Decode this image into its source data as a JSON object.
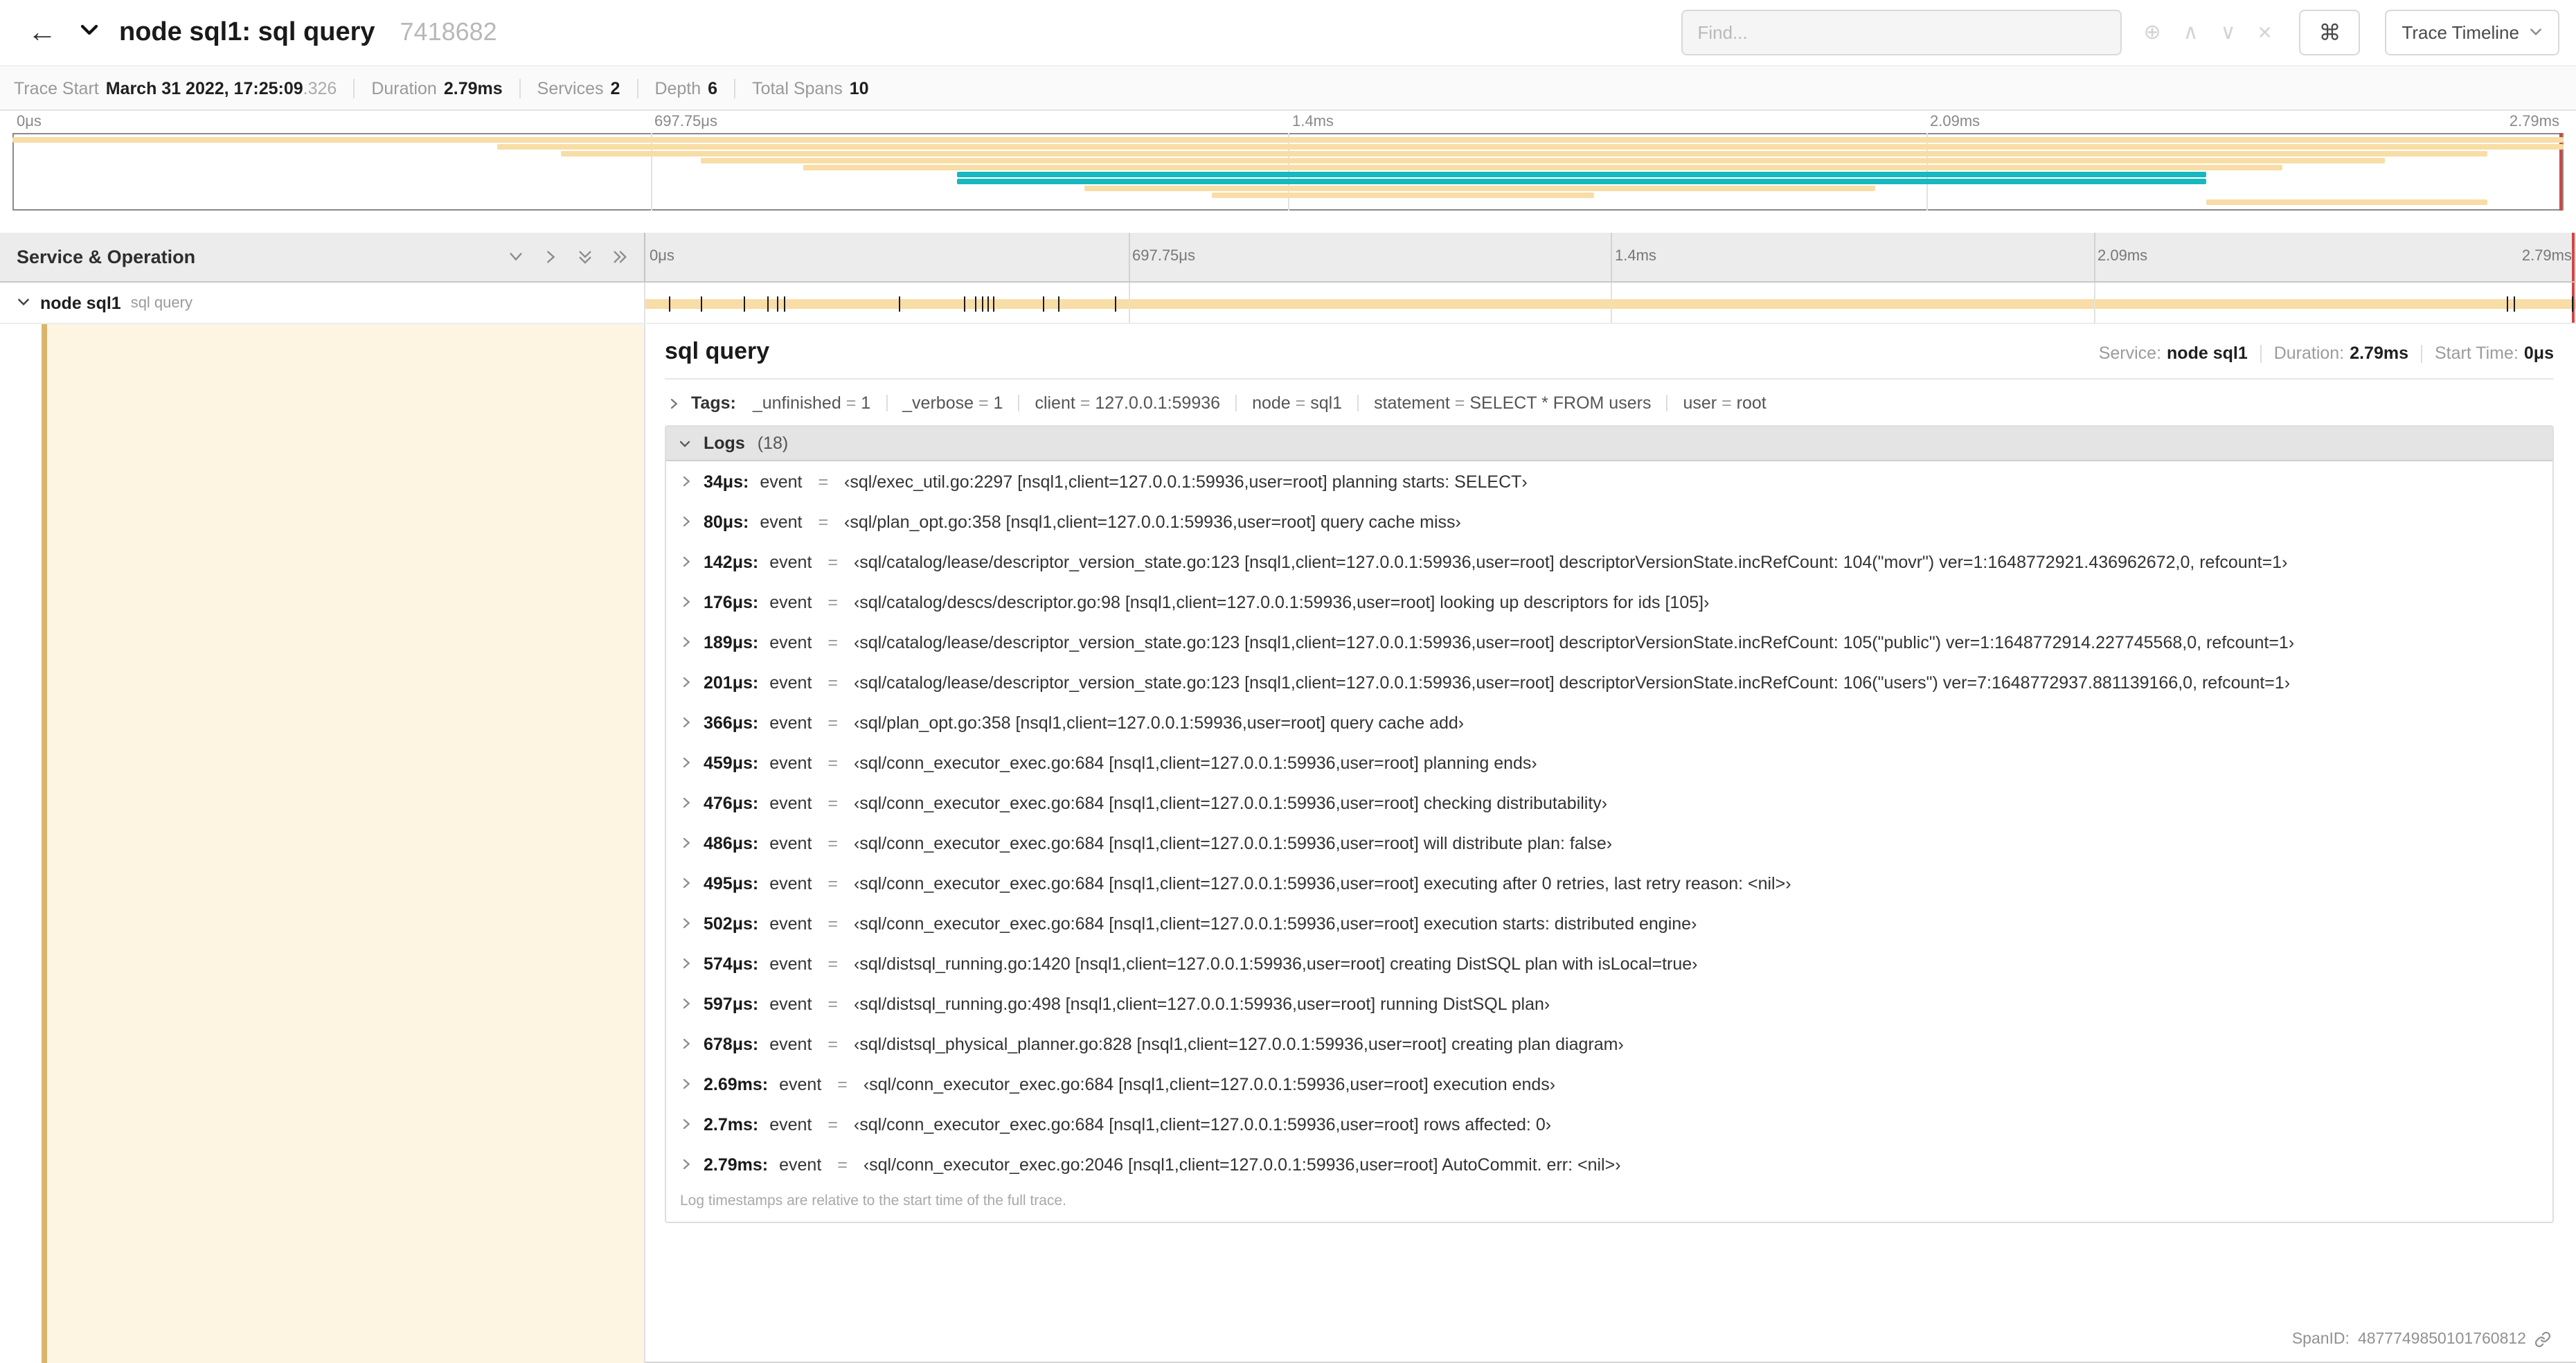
{
  "header": {
    "title": "node sql1: sql query",
    "trace_id": "7418682",
    "find_placeholder": "Find...",
    "command_key": "⌘",
    "view_selector": "Trace Timeline"
  },
  "summary": {
    "items": [
      {
        "label": "Trace Start",
        "value": "March 31 2022, 17:25:09",
        "suffix": ".326"
      },
      {
        "label": "Duration",
        "value": "2.79ms"
      },
      {
        "label": "Services",
        "value": "2"
      },
      {
        "label": "Depth",
        "value": "6"
      },
      {
        "label": "Total Spans",
        "value": "10"
      }
    ]
  },
  "timeline": {
    "ticks": [
      "0μs",
      "697.75μs",
      "1.4ms",
      "2.09ms",
      "2.79ms"
    ],
    "colors": {
      "tan": "#F8DDA6",
      "teal": "#17B8BE"
    },
    "minimap_spans": [
      {
        "row": 0,
        "start": 0,
        "end": 100,
        "color": "tan"
      },
      {
        "row": 1,
        "start": 19,
        "end": 100,
        "color": "tan"
      },
      {
        "row": 2,
        "start": 21.5,
        "end": 97,
        "color": "tan"
      },
      {
        "row": 3,
        "start": 27,
        "end": 93,
        "color": "tan"
      },
      {
        "row": 4,
        "start": 31,
        "end": 89,
        "color": "tan"
      },
      {
        "row": 5,
        "start": 37,
        "end": 86,
        "color": "teal"
      },
      {
        "row": 6,
        "start": 37,
        "end": 86,
        "color": "teal"
      },
      {
        "row": 7,
        "start": 42,
        "end": 73,
        "color": "tan"
      },
      {
        "row": 8,
        "start": 47,
        "end": 62,
        "color": "tan"
      },
      {
        "row": 9,
        "start": 86,
        "end": 97,
        "color": "tan"
      }
    ],
    "log_marker_pcts": [
      1.2,
      2.9,
      5.1,
      6.3,
      6.8,
      7.2,
      13.1,
      16.5,
      17.1,
      17.4,
      17.7,
      18,
      20.6,
      21.4,
      24.3,
      96.4,
      96.8,
      99.8
    ]
  },
  "left_panel": {
    "header": "Service & Operation",
    "span": {
      "service": "node sql1",
      "operation": "sql query"
    }
  },
  "detail": {
    "title": "sql query",
    "stats": [
      {
        "label": "Service:",
        "value": "node sql1"
      },
      {
        "label": "Duration:",
        "value": "2.79ms"
      },
      {
        "label": "Start Time:",
        "value": "0μs"
      }
    ],
    "tags_label": "Tags:",
    "tags": [
      {
        "key": "_unfinished",
        "value": "1"
      },
      {
        "key": "_verbose",
        "value": "1"
      },
      {
        "key": "client",
        "value": "127.0.0.1:59936"
      },
      {
        "key": "node",
        "value": "sql1"
      },
      {
        "key": "statement",
        "value": "SELECT * FROM users"
      },
      {
        "key": "user",
        "value": "root"
      }
    ],
    "logs_title": "Logs",
    "logs_count": "(18)",
    "logs": [
      {
        "time": "34μs:",
        "key": "event",
        "value": "‹sql/exec_util.go:2297 [nsql1,client=127.0.0.1:59936,user=root] planning starts: SELECT›"
      },
      {
        "time": "80μs:",
        "key": "event",
        "value": "‹sql/plan_opt.go:358 [nsql1,client=127.0.0.1:59936,user=root] query cache miss›"
      },
      {
        "time": "142μs:",
        "key": "event",
        "value": "‹sql/catalog/lease/descriptor_version_state.go:123 [nsql1,client=127.0.0.1:59936,user=root] descriptorVersionState.incRefCount: 104(\"movr\") ver=1:1648772921.436962672,0, refcount=1›"
      },
      {
        "time": "176μs:",
        "key": "event",
        "value": "‹sql/catalog/descs/descriptor.go:98 [nsql1,client=127.0.0.1:59936,user=root] looking up descriptors for ids [105]›"
      },
      {
        "time": "189μs:",
        "key": "event",
        "value": "‹sql/catalog/lease/descriptor_version_state.go:123 [nsql1,client=127.0.0.1:59936,user=root] descriptorVersionState.incRefCount: 105(\"public\") ver=1:1648772914.227745568,0, refcount=1›"
      },
      {
        "time": "201μs:",
        "key": "event",
        "value": "‹sql/catalog/lease/descriptor_version_state.go:123 [nsql1,client=127.0.0.1:59936,user=root] descriptorVersionState.incRefCount: 106(\"users\") ver=7:1648772937.881139166,0, refcount=1›"
      },
      {
        "time": "366μs:",
        "key": "event",
        "value": "‹sql/plan_opt.go:358 [nsql1,client=127.0.0.1:59936,user=root] query cache add›"
      },
      {
        "time": "459μs:",
        "key": "event",
        "value": "‹sql/conn_executor_exec.go:684 [nsql1,client=127.0.0.1:59936,user=root] planning ends›"
      },
      {
        "time": "476μs:",
        "key": "event",
        "value": "‹sql/conn_executor_exec.go:684 [nsql1,client=127.0.0.1:59936,user=root] checking distributability›"
      },
      {
        "time": "486μs:",
        "key": "event",
        "value": "‹sql/conn_executor_exec.go:684 [nsql1,client=127.0.0.1:59936,user=root] will distribute plan: false›"
      },
      {
        "time": "495μs:",
        "key": "event",
        "value": "‹sql/conn_executor_exec.go:684 [nsql1,client=127.0.0.1:59936,user=root] executing after 0 retries, last retry reason: <nil>›"
      },
      {
        "time": "502μs:",
        "key": "event",
        "value": "‹sql/conn_executor_exec.go:684 [nsql1,client=127.0.0.1:59936,user=root] execution starts: distributed engine›"
      },
      {
        "time": "574μs:",
        "key": "event",
        "value": "‹sql/distsql_running.go:1420 [nsql1,client=127.0.0.1:59936,user=root] creating DistSQL plan with isLocal=true›"
      },
      {
        "time": "597μs:",
        "key": "event",
        "value": "‹sql/distsql_running.go:498 [nsql1,client=127.0.0.1:59936,user=root] running DistSQL plan›"
      },
      {
        "time": "678μs:",
        "key": "event",
        "value": "‹sql/distsql_physical_planner.go:828 [nsql1,client=127.0.0.1:59936,user=root] creating plan diagram›"
      },
      {
        "time": "2.69ms:",
        "key": "event",
        "value": "‹sql/conn_executor_exec.go:684 [nsql1,client=127.0.0.1:59936,user=root] execution ends›"
      },
      {
        "time": "2.7ms:",
        "key": "event",
        "value": "‹sql/conn_executor_exec.go:684 [nsql1,client=127.0.0.1:59936,user=root] rows affected: 0›"
      },
      {
        "time": "2.79ms:",
        "key": "event",
        "value": "‹sql/conn_executor_exec.go:2046 [nsql1,client=127.0.0.1:59936,user=root] AutoCommit. err: <nil>›"
      }
    ],
    "logs_footer": "Log timestamps are relative to the start time of the full trace.",
    "span_id_label": "SpanID:",
    "span_id_value": "4877749850101760812"
  }
}
